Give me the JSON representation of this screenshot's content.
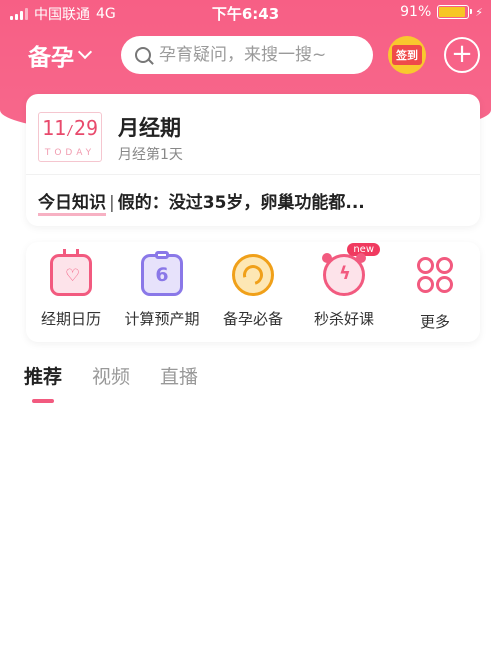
{
  "status_bar": {
    "carrier": "中国联通",
    "network": "4G",
    "time": "下午6:43",
    "battery_pct": "91%",
    "battery_level": 0.91
  },
  "nav": {
    "mode_label": "备孕",
    "search_placeholder": "孕育疑问，来搜一搜~",
    "checkin_label": "签到",
    "add_label": "+"
  },
  "period_card": {
    "date_month": "11",
    "date_day": "29",
    "date_today": "TODAY",
    "phase_title": "月经期",
    "phase_subtitle": "月经第1天",
    "knowledge_tag": "今日知识",
    "knowledge_separator": "|",
    "knowledge_text": "假的：没过35岁，卵巢功能都..."
  },
  "tools": [
    {
      "label": "经期日历",
      "icon": "calendar-heart-icon"
    },
    {
      "label": "计算预产期",
      "icon": "clipboard-icon"
    },
    {
      "label": "备孕必备",
      "icon": "cookie-icon"
    },
    {
      "label": "秒杀好课",
      "icon": "alarm-clock-icon",
      "badge": "new"
    },
    {
      "label": "更多",
      "icon": "grid-icon"
    }
  ],
  "tabs": [
    {
      "label": "推荐",
      "active": true
    },
    {
      "label": "视频",
      "active": false
    },
    {
      "label": "直播",
      "active": false
    }
  ],
  "colors": {
    "brand_pink": "#f75f85",
    "checkin_yellow": "#f9c82e",
    "accent_purple": "#8a78e8",
    "accent_orange": "#f0a019"
  }
}
